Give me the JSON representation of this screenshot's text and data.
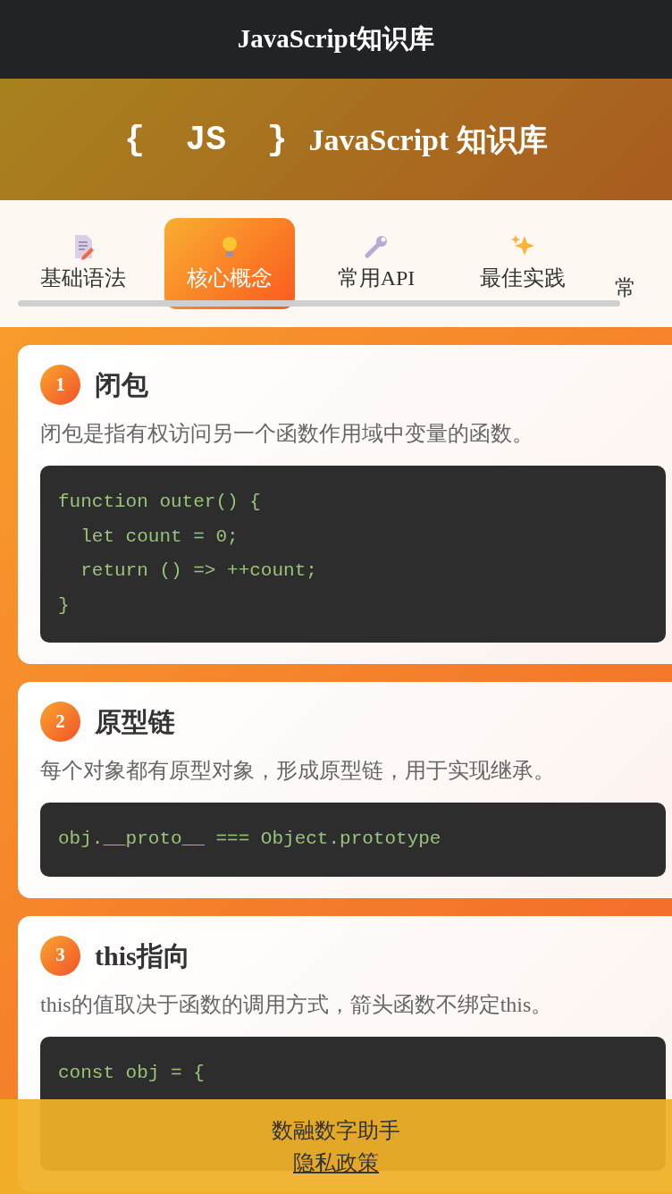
{
  "navbar": {
    "title": "JavaScript知识库"
  },
  "hero": {
    "logo_text": "{ JS }",
    "title": "JavaScript 知识库"
  },
  "tabs": [
    {
      "label": "基础语法",
      "selected": false
    },
    {
      "label": "核心概念",
      "selected": true
    },
    {
      "label": "常用API",
      "selected": false
    },
    {
      "label": "最佳实践",
      "selected": false
    },
    {
      "label": "常",
      "selected": false
    }
  ],
  "cards": [
    {
      "number": "1",
      "title": "闭包",
      "description": "闭包是指有权访问另一个函数作用域中变量的函数。",
      "code": [
        "function outer() {",
        "  let count = 0;",
        "  return () => ++count;",
        "}"
      ]
    },
    {
      "number": "2",
      "title": "原型链",
      "description": "每个对象都有原型对象，形成原型链，用于实现继承。",
      "code": [
        "obj.__proto__ === Object.prototype"
      ]
    },
    {
      "number": "3",
      "title": "this指向",
      "description": "this的值取决于函数的调用方式，箭头函数不绑定this。",
      "code": [
        "const obj = {"
      ]
    }
  ],
  "footer": {
    "text": "数融数字助手",
    "link": "隐私政策"
  }
}
